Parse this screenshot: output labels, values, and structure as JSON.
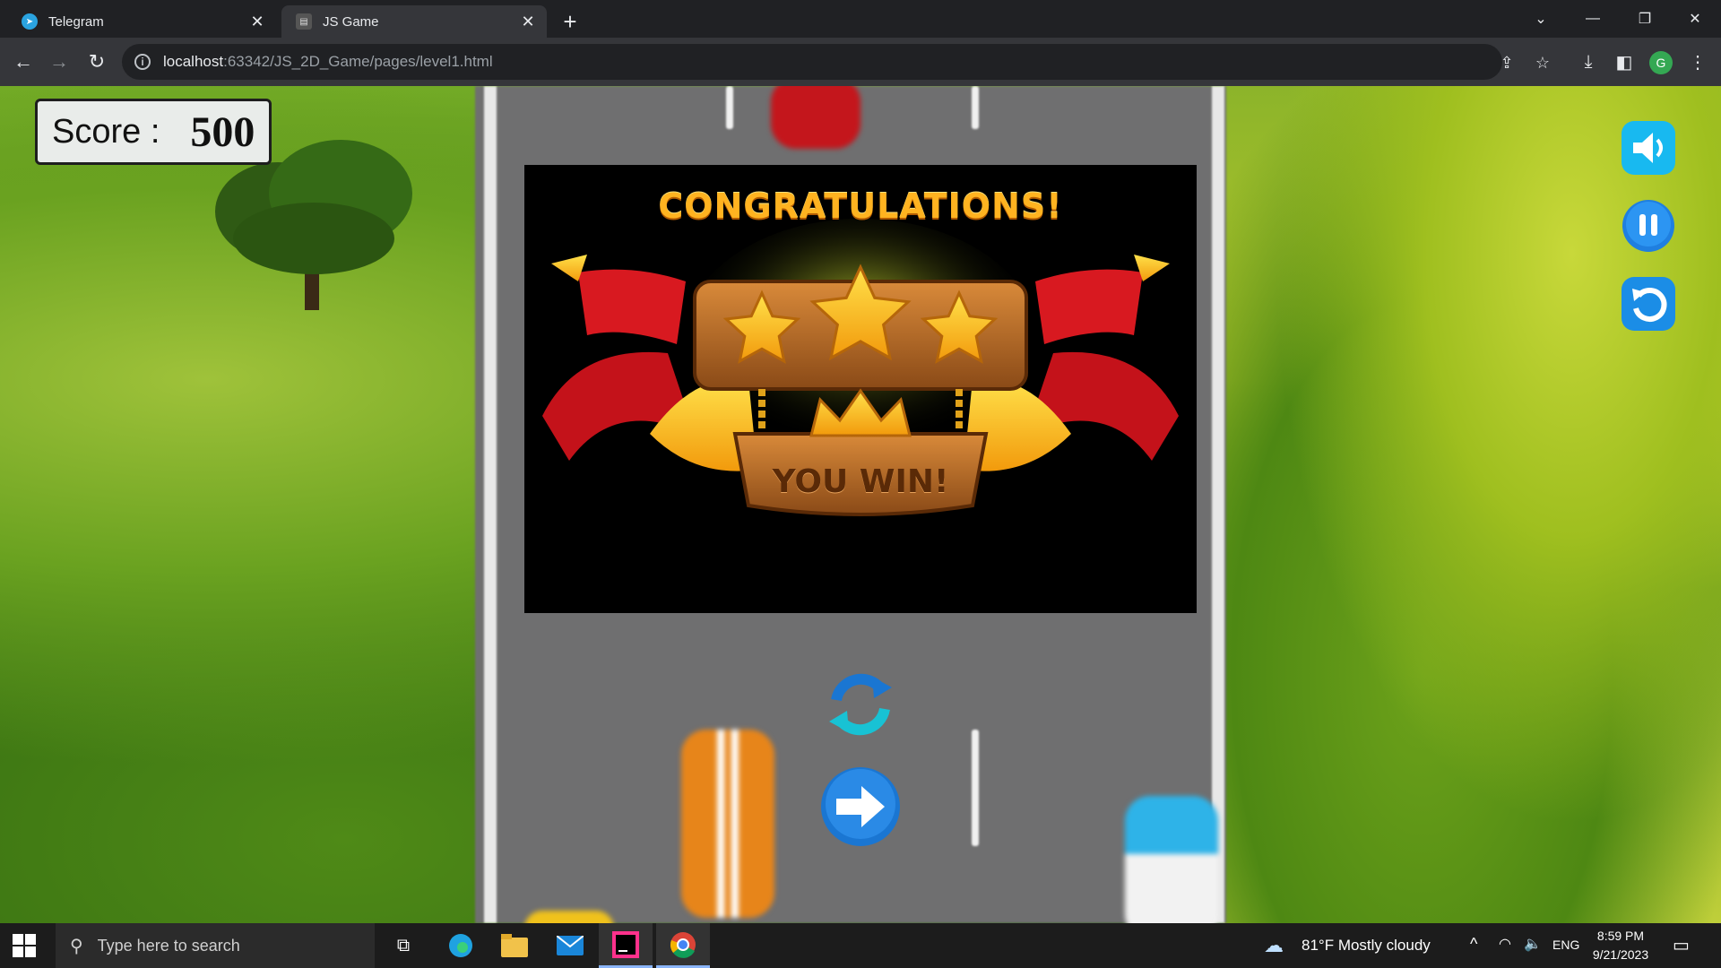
{
  "browser": {
    "tabs": [
      {
        "title": "Telegram",
        "icon": "telegram-icon",
        "active": false
      },
      {
        "title": "JS Game",
        "icon": "page-icon",
        "active": true
      }
    ],
    "url_host": "localhost",
    "url_rest": ":63342/JS_2D_Game/pages/level1.html",
    "profile_initial": "G"
  },
  "game": {
    "score_label": "Score :",
    "score_value": "500",
    "win_title": "CONGRATULATIONS!",
    "win_banner": "YOU WIN!",
    "stars_earned": 3,
    "hud_buttons": [
      "sound-icon",
      "pause-icon",
      "restart-icon"
    ],
    "actions": [
      "replay-icon",
      "next-level-icon"
    ]
  },
  "taskbar": {
    "search_placeholder": "Type here to search",
    "weather": "81°F  Mostly cloudy",
    "language": "ENG",
    "time": "8:59 PM",
    "date": "9/21/2023"
  }
}
